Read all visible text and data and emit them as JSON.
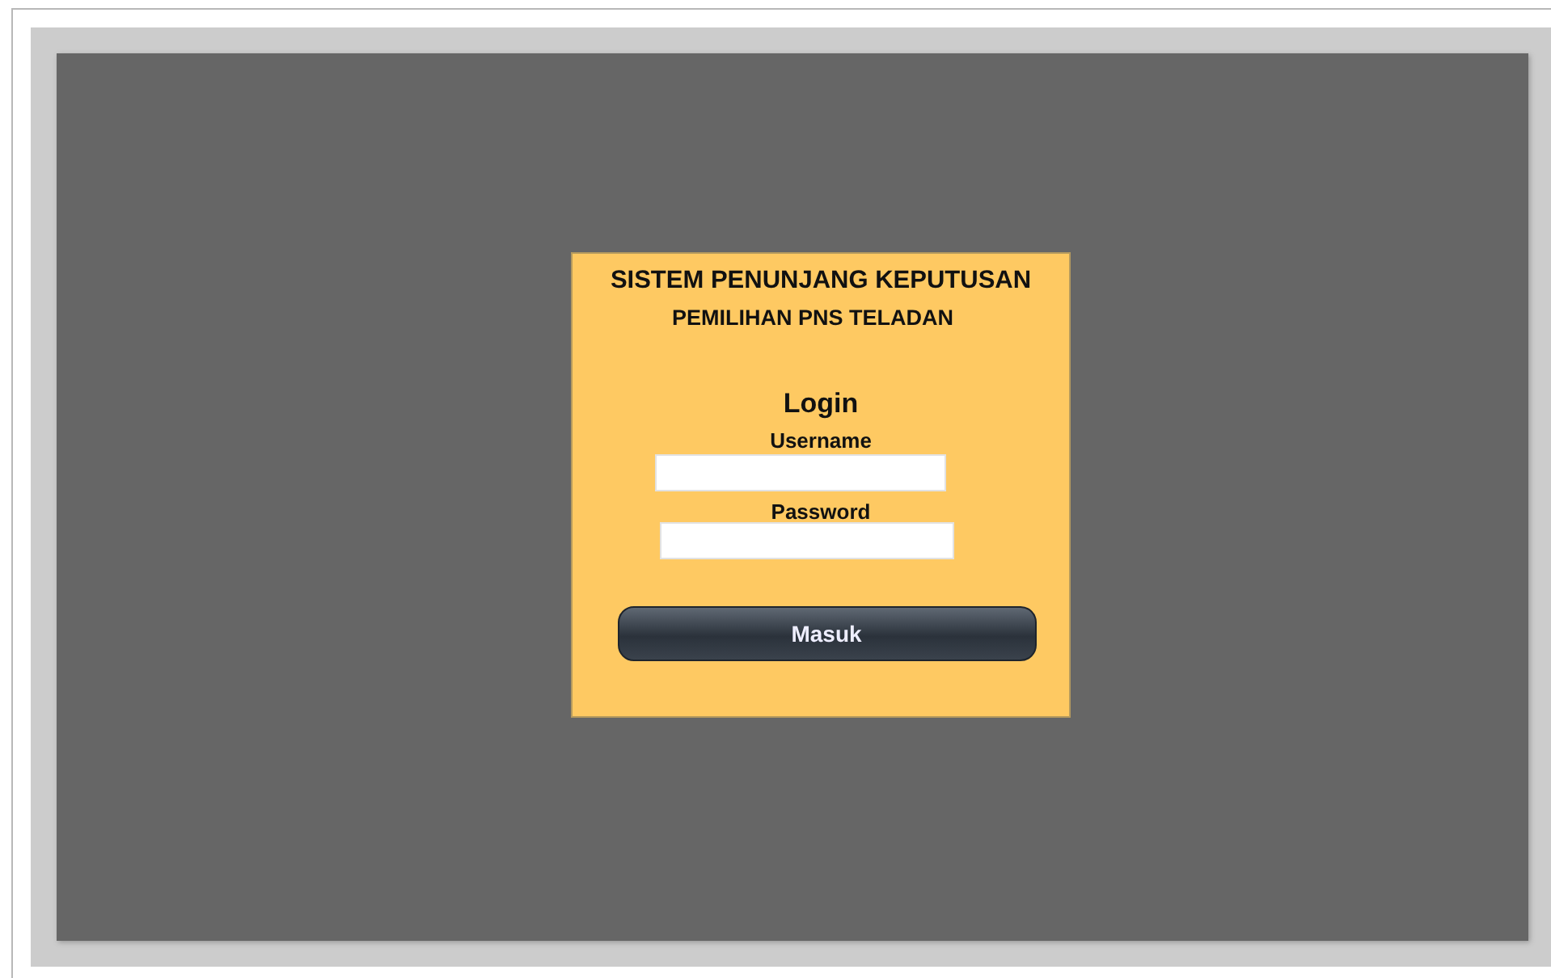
{
  "header": {
    "title": "SISTEM PENUNJANG KEPUTUSAN",
    "subtitle": "PEMILIHAN PNS TELADAN"
  },
  "login": {
    "heading": "Login",
    "fields": [
      {
        "label": "Username"
      },
      {
        "label": "Password"
      }
    ],
    "button": "Masuk"
  }
}
